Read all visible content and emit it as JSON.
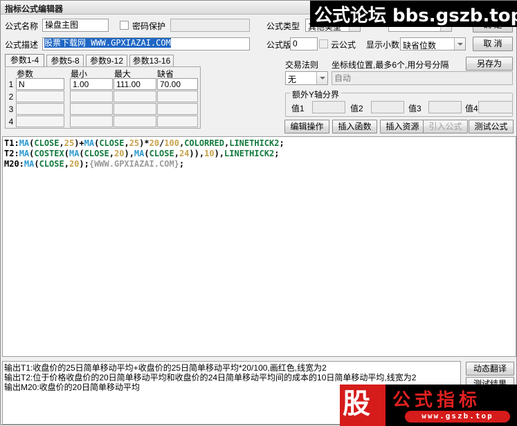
{
  "window": {
    "title": "指标公式编辑器"
  },
  "form": {
    "name_label": "公式名称",
    "name_value": "操盘主图",
    "password_protect_label": "密码保护",
    "password_value": "",
    "desc_label": "公式描述",
    "desc_value": "股票下载网 WWW.GPXIAZAI.COM",
    "type_label": "公式类型",
    "type_value": "其他类型",
    "type_value2": "",
    "version_label": "公式版本",
    "version_value": "0",
    "cloud_label": "云公式",
    "decimals_label": "显示小数",
    "decimals_value": "缺省位数"
  },
  "top_buttons": {
    "ok_label": "确  定",
    "cancel_label": "取  消",
    "saveas_label": "另存为"
  },
  "param_tabs": [
    {
      "label": "参数1-4",
      "active": true
    },
    {
      "label": "参数5-8",
      "active": false
    },
    {
      "label": "参数9-12",
      "active": false
    },
    {
      "label": "参数13-16",
      "active": false
    }
  ],
  "param_table": {
    "headers": [
      "参数",
      "最小",
      "最大",
      "缺省"
    ],
    "rows": [
      {
        "no": "1",
        "name": "N",
        "min": "1.00",
        "max": "111.00",
        "def": "70.00"
      },
      {
        "no": "2",
        "name": "",
        "min": "",
        "max": "",
        "def": ""
      },
      {
        "no": "3",
        "name": "",
        "min": "",
        "max": "",
        "def": ""
      },
      {
        "no": "4",
        "name": "",
        "min": "",
        "max": "",
        "def": ""
      }
    ]
  },
  "right_panel": {
    "trade_rule_label": "交易法则",
    "trade_rule_value": "无",
    "axis_label": "坐标线位置,最多6个,用分号分隔",
    "axis_placeholder": "自动",
    "axis_value": "",
    "group_title": "额外Y轴分界",
    "values": [
      {
        "label": "值1",
        "value": ""
      },
      {
        "label": "值2",
        "value": ""
      },
      {
        "label": "值3",
        "value": ""
      },
      {
        "label": "值4",
        "value": ""
      }
    ]
  },
  "action_buttons": [
    {
      "label": "编辑操作",
      "enabled": true
    },
    {
      "label": "插入函数",
      "enabled": true
    },
    {
      "label": "插入资源",
      "enabled": true
    },
    {
      "label": "引入公式",
      "enabled": false
    },
    {
      "label": "测试公式",
      "enabled": true
    }
  ],
  "code": {
    "lines": [
      [
        {
          "t": "T1:",
          "c": "tkN"
        },
        {
          "t": "MA",
          "c": "tkF"
        },
        {
          "t": "(",
          "c": "tkP"
        },
        {
          "t": "CLOSE",
          "c": "tkK"
        },
        {
          "t": ",",
          "c": "tkP"
        },
        {
          "t": "25",
          "c": "tkNum"
        },
        {
          "t": ")+",
          "c": "tkP"
        },
        {
          "t": "MA",
          "c": "tkF"
        },
        {
          "t": "(",
          "c": "tkP"
        },
        {
          "t": "CLOSE",
          "c": "tkK"
        },
        {
          "t": ",",
          "c": "tkP"
        },
        {
          "t": "25",
          "c": "tkNum"
        },
        {
          "t": ")*",
          "c": "tkP"
        },
        {
          "t": "20",
          "c": "tkNum"
        },
        {
          "t": "/",
          "c": "tkP"
        },
        {
          "t": "100",
          "c": "tkNum"
        },
        {
          "t": ",",
          "c": "tkP"
        },
        {
          "t": "COLORRED",
          "c": "tkK"
        },
        {
          "t": ",",
          "c": "tkP"
        },
        {
          "t": "LINETHICK2",
          "c": "tkK"
        },
        {
          "t": ";",
          "c": "tkP"
        }
      ],
      [
        {
          "t": "T2:",
          "c": "tkN"
        },
        {
          "t": "MA",
          "c": "tkF"
        },
        {
          "t": "(",
          "c": "tkP"
        },
        {
          "t": "COSTEX",
          "c": "tkK"
        },
        {
          "t": "(",
          "c": "tkP"
        },
        {
          "t": "MA",
          "c": "tkF"
        },
        {
          "t": "(",
          "c": "tkP"
        },
        {
          "t": "CLOSE",
          "c": "tkK"
        },
        {
          "t": ",",
          "c": "tkP"
        },
        {
          "t": "20",
          "c": "tkNum"
        },
        {
          "t": "),",
          "c": "tkP"
        },
        {
          "t": "MA",
          "c": "tkF"
        },
        {
          "t": "(",
          "c": "tkP"
        },
        {
          "t": "CLOSE",
          "c": "tkK"
        },
        {
          "t": ",",
          "c": "tkP"
        },
        {
          "t": "24",
          "c": "tkNum"
        },
        {
          "t": ")),",
          "c": "tkP"
        },
        {
          "t": "10",
          "c": "tkNum"
        },
        {
          "t": "),",
          "c": "tkP"
        },
        {
          "t": "LINETHICK2",
          "c": "tkK"
        },
        {
          "t": ";",
          "c": "tkP"
        }
      ],
      [
        {
          "t": "M20:",
          "c": "tkN"
        },
        {
          "t": "MA",
          "c": "tkF"
        },
        {
          "t": "(",
          "c": "tkP"
        },
        {
          "t": "CLOSE",
          "c": "tkK"
        },
        {
          "t": ",",
          "c": "tkP"
        },
        {
          "t": "20",
          "c": "tkNum"
        },
        {
          "t": ");",
          "c": "tkP"
        },
        {
          "t": "{WWW.GPXIAZAI.COM}",
          "c": "tkC"
        },
        {
          "t": ";",
          "c": "tkP"
        }
      ]
    ]
  },
  "output": {
    "lines": [
      "输出T1:收盘价的25日简单移动平均+收盘价的25日简单移动平均*20/100,画红色,线宽为2",
      "输出T2:位于价格收盘价的20日简单移动平均和收盘价的24日简单移动平均间的成本的10日简单移动平均,线宽为2",
      "输出M20:收盘价的20日简单移动平均"
    ]
  },
  "side_buttons": [
    {
      "label": "动态翻译"
    },
    {
      "label": "测试结果"
    }
  ],
  "watermarks": {
    "top": "公式论坛 bbs.gszb.top",
    "bottom_logo": "股",
    "bottom_title": "公式指标",
    "bottom_url": "www.gszb.top"
  },
  "colors": {
    "accent_blue": "#2f9ad0",
    "keyword_green": "#127a3d",
    "number_gold": "#c8a24a",
    "watermark_red": "#d61b1b",
    "selection_blue": "#1f67c4"
  }
}
